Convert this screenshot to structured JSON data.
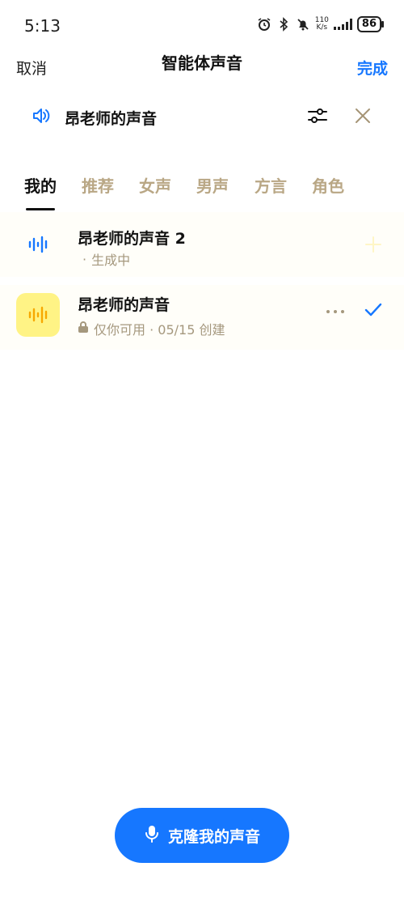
{
  "status": {
    "time": "5:13",
    "net_speed_value": "110",
    "net_speed_unit": "K/s",
    "battery": "86"
  },
  "header": {
    "cancel_label": "取消",
    "title": "智能体声音",
    "done_label": "完成"
  },
  "current": {
    "name": "昂老师的声音",
    "speaker_icon": "speaker-icon",
    "filter_icon": "sliders-icon",
    "close_icon": "close-icon"
  },
  "tabs": [
    {
      "label": "我的",
      "active": true
    },
    {
      "label": "推荐"
    },
    {
      "label": "女声"
    },
    {
      "label": "男声"
    },
    {
      "label": "方言"
    },
    {
      "label": "角色"
    }
  ],
  "voices": [
    {
      "name": "昂老师的声音 2",
      "status": "生成中",
      "icon": "waveform-icon"
    },
    {
      "name": "昂老师的声音",
      "meta": "仅你可用 · 05/15 创建",
      "icon": "waveform-icon",
      "selected": true
    }
  ],
  "clone_button": {
    "label": "克隆我的声音"
  },
  "colors": {
    "accent": "#1677ff",
    "tab_inactive": "#b9a785",
    "thumb_yellow": "#fff385",
    "wave_orange": "#f7a800"
  }
}
